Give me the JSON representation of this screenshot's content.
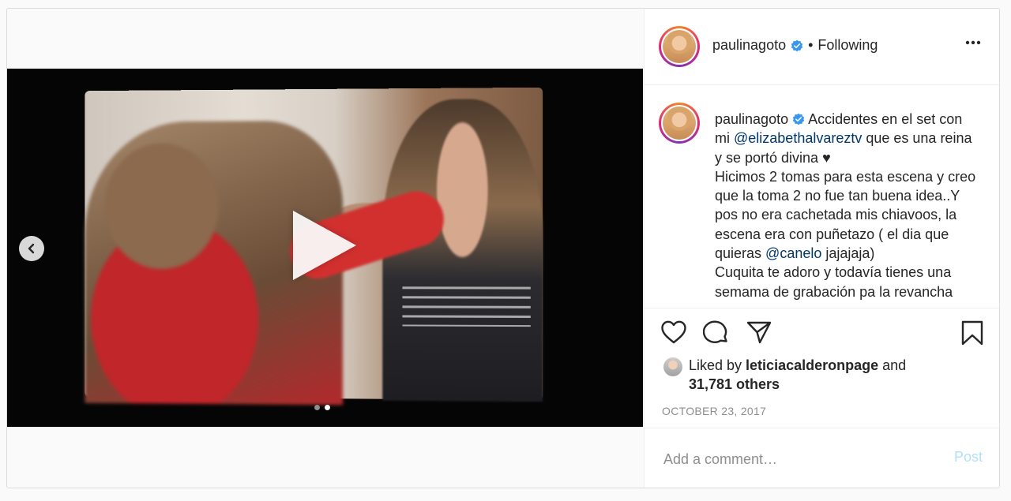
{
  "post": {
    "username": "paulinagoto",
    "follow_status": "Following",
    "caption_line1": " Accidentes en el set con mi ",
    "caption_mention1": "@elizabethalvareztv",
    "caption_line2": " que es una reina y se portó divina ♥",
    "caption_line3": "Hicimos 2 tomas para esta escena y creo que la toma 2 no fue tan buena idea..Y pos no era cachetada mis chiavoos, la escena era con puñetazo ( el dia que quieras ",
    "caption_mention2": "@canelo",
    "caption_line4": " jajajaja)",
    "caption_line5": "Cuquita te adoro y todavía tienes una semama de grabación pa la revancha",
    "liked_by_prefix": "Liked by ",
    "liked_by_user": "leticiacalderonpage",
    "liked_by_and": " and",
    "liked_others": "31,781 others",
    "date": "OCTOBER 23, 2017",
    "carousel": {
      "count": 2,
      "active": 2
    }
  },
  "comment": {
    "placeholder": "Add a comment…",
    "post_label": "Post"
  },
  "icons": {
    "verified": "verified-badge-icon",
    "more": "more-options-icon",
    "like": "heart-icon",
    "comment": "comment-bubble-icon",
    "share": "paper-plane-icon",
    "save": "bookmark-icon",
    "play": "play-icon",
    "prev": "chevron-left-icon"
  },
  "colors": {
    "link": "#00376b",
    "verified": "#3897f0",
    "post_disabled": "#b2dffc",
    "muted": "#8e8e8e"
  }
}
